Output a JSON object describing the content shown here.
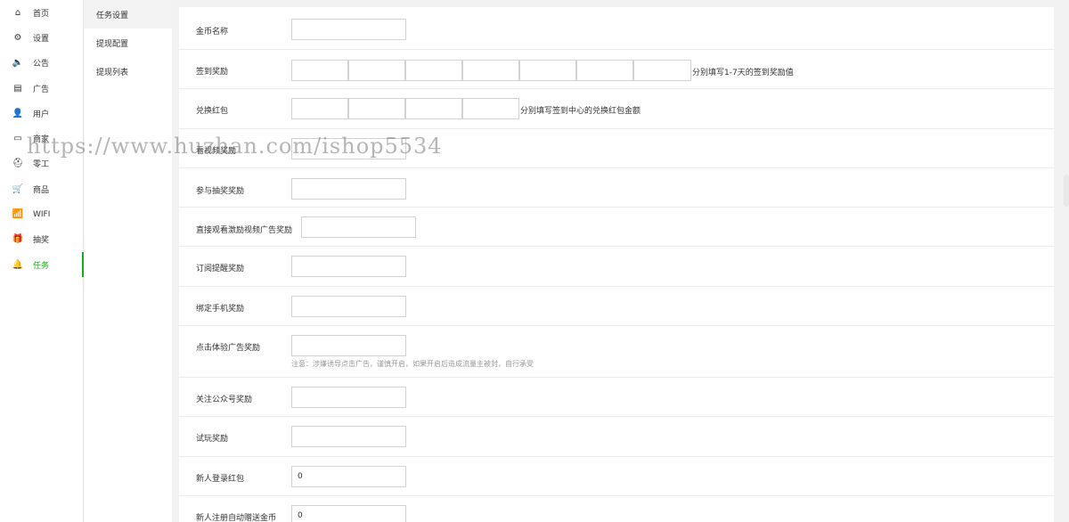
{
  "sidebar": {
    "items": [
      {
        "label": "首页",
        "icon": "home-icon",
        "glyph": "⌂"
      },
      {
        "label": "设置",
        "icon": "gear-icon",
        "glyph": "⚙"
      },
      {
        "label": "公告",
        "icon": "speaker-icon",
        "glyph": "🔈"
      },
      {
        "label": "广告",
        "icon": "document-icon",
        "glyph": "▤"
      },
      {
        "label": "用户",
        "icon": "user-icon",
        "glyph": "👤"
      },
      {
        "label": "商家",
        "icon": "store-icon",
        "glyph": "▭"
      },
      {
        "label": "零工",
        "icon": "worker-icon",
        "glyph": "⛑"
      },
      {
        "label": "商品",
        "icon": "cart-icon",
        "glyph": "🛒"
      },
      {
        "label": "WIFI",
        "icon": "wifi-icon",
        "glyph": "📶"
      },
      {
        "label": "抽奖",
        "icon": "gift-icon",
        "glyph": "🎁"
      },
      {
        "label": "任务",
        "icon": "bell-icon",
        "glyph": "🔔"
      }
    ],
    "active_index": 10,
    "accent_color": "#1aad19"
  },
  "subnav": {
    "items": [
      "任务设置",
      "提现配置",
      "提现列表"
    ],
    "active_index": 0
  },
  "form": {
    "coin_name": {
      "label": "金币名称",
      "value": ""
    },
    "signin": {
      "label": "签到奖励",
      "values": [
        "",
        "",
        "",
        "",
        "",
        "",
        ""
      ],
      "hint": "分别填写1-7天的签到奖励值"
    },
    "redpack": {
      "label": "兑换红包",
      "values": [
        "",
        "",
        "",
        ""
      ],
      "hint": "分别填写签到中心的兑换红包金额"
    },
    "row4": {
      "label": "看视频奖励",
      "value": ""
    },
    "lottery": {
      "label": "参与抽奖奖励",
      "value": ""
    },
    "video_ad": {
      "label": "直接观看激励视频广告奖励",
      "value": ""
    },
    "subscribe": {
      "label": "订阅提醒奖励",
      "value": ""
    },
    "bind_phone": {
      "label": "绑定手机奖励",
      "value": ""
    },
    "click_ad": {
      "label": "点击体验广告奖励",
      "value": "",
      "note": "注意：涉嫌诱导点击广告，谨慎开启，如果开启后造成流量主被封，自行承受"
    },
    "follow_mp": {
      "label": "关注公众号奖励",
      "value": ""
    },
    "trial": {
      "label": "试玩奖励",
      "value": ""
    },
    "new_login": {
      "label": "新人登录红包",
      "value": "0"
    },
    "new_register": {
      "label": "新人注册自动赠送金币",
      "value": "0"
    }
  },
  "watermark": "https://www.huzhan.com/ishop5534"
}
